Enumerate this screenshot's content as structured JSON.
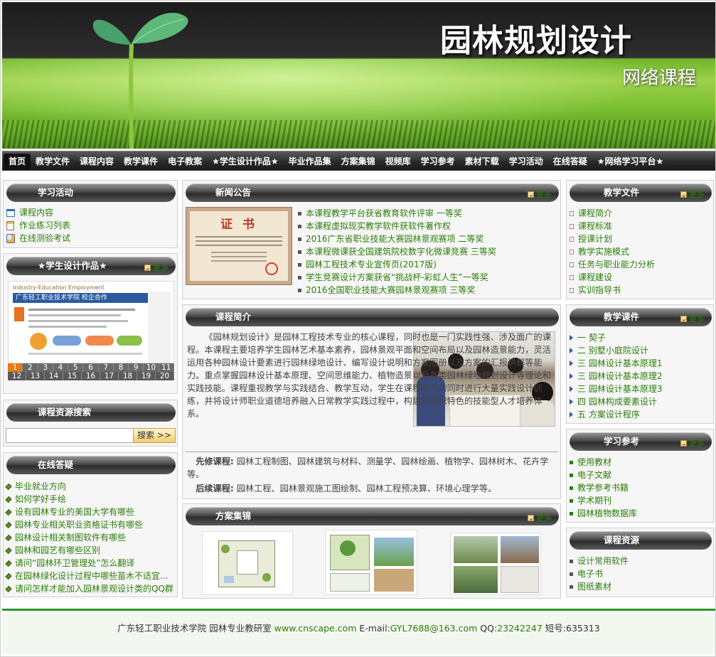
{
  "banner": {
    "title": "园林规划设计",
    "subtitle": "网络课程"
  },
  "nav": [
    {
      "label": "首页",
      "active": true
    },
    {
      "label": "教学文件"
    },
    {
      "label": "课程内容"
    },
    {
      "label": "教学课件"
    },
    {
      "label": "电子教案"
    },
    {
      "label": "★学生设计作品★"
    },
    {
      "label": "毕业作品集"
    },
    {
      "label": "方案集锦"
    },
    {
      "label": "视频库"
    },
    {
      "label": "学习参考"
    },
    {
      "label": "素材下载"
    },
    {
      "label": "学习活动"
    },
    {
      "label": "在线答疑"
    },
    {
      "label": "★网络学习平台★"
    }
  ],
  "more_label": "更多",
  "activity": {
    "title": "学习活动",
    "items": [
      {
        "label": "课程内容",
        "icon": "window-icon"
      },
      {
        "label": "作业练习列表",
        "icon": "notepad-icon"
      },
      {
        "label": "在线测验考试",
        "icon": "exam-icon"
      }
    ]
  },
  "student_works": {
    "title": "★学生设计作品★",
    "poster_title": "广东轻工职业技术学院 校企合作",
    "poster_sub": "Industry-Education Employment",
    "pages_row1": [
      "1",
      "2",
      "3",
      "4",
      "5",
      "6",
      "7",
      "8",
      "9",
      "10",
      "11"
    ],
    "pages_row2": [
      "12",
      "13",
      "14",
      "15",
      "16",
      "17",
      "18",
      "19",
      "20"
    ],
    "current_page": "1"
  },
  "search": {
    "title": "课程资源搜索",
    "placeholder": "",
    "button": "搜索 >>"
  },
  "qa": {
    "title": "在线答疑",
    "items": [
      "毕业就业方向",
      "如何学好手绘",
      "设有园林专业的美国大学有哪些",
      "园林专业相关职业资格证书有哪些",
      "园林设计相关制图软件有哪些",
      "园林和园艺有哪些区别",
      "请问“园林环卫管理处”怎么翻译",
      "在园林绿化设计过程中哪些苗木不适宜...",
      "请问怎样才能加入园林景观设计类的QQ群"
    ]
  },
  "news": {
    "title": "新闻公告",
    "cert_title": "证 书",
    "items": [
      "本课程教学平台获省教育软件评审 一等奖",
      "本课程虚拟现实教学软件获软件著作权",
      "2016广东省职业技能大赛园林景观赛项 二等奖",
      "本课程微课获全国建筑院校数字化微课竞赛 三等奖",
      "园林工程技术专业宣传页(2017版)",
      "学生竞赛设计方案获省“挑战杯-彩虹人生”一等奖",
      "2016全国职业技能大赛园林景观赛项 三等奖"
    ]
  },
  "intro": {
    "title": "课程简介",
    "text": "《园林规划设计》是园林工程技术专业的核心课程，同时也是一门实践性强、涉及面广的课程。本课程主要培养学生园林艺术基本素养，园林景观平面和空间布局以及园林造景能力，灵活运用各种园林设计要素进行园林绿地设计、编写设计说明和方案图册以及方案的汇报讲解等能力。重点掌握园林设计基本原理、空间思维能力、植物造景以及各类园林绿地规划设计等理论和实践技能。课程重视教学与实践结合、教学互动，学生在课程学习的同时进行大量实践设计训练，并将设计师职业道德培养融入日常教学实践过程中，构建具高职特色的技能型人才培养体系。",
    "pre_label": "先修课程:",
    "pre_text": "园林工程制图、园林建筑与材料、测量学、园林绘画、植物学、园林树木、花卉学等。",
    "post_label": "后续课程:",
    "post_text": "园林工程、园林景观施工图绘制、园林工程预决算、环境心理学等。"
  },
  "plans": {
    "title": "方案集锦"
  },
  "files": {
    "title": "教学文件",
    "items": [
      "课程简介",
      "课程标准",
      "授课计划",
      "教学实施模式",
      "任务与职业能力分析",
      "课程建设",
      "实训指导书"
    ]
  },
  "slides": {
    "title": "教学课件",
    "items": [
      "一 契子",
      "二 别墅小庭院设计",
      "三 园林设计基本原理1",
      "三 园林设计基本原理2",
      "三 园林设计基本原理3",
      "四 园林构成要素设计",
      "五 方案设计程序"
    ]
  },
  "refs": {
    "title": "学习参考",
    "items": [
      "使用教材",
      "电子文献",
      "教学参考书籍",
      "学术期刊",
      "园林植物数据库"
    ]
  },
  "resources": {
    "title": "课程资源",
    "items": [
      "设计常用软件",
      "电子书",
      "图纸素材"
    ]
  },
  "footer": {
    "school": "广东轻工职业技术学院 园林专业教研室",
    "site": "www.cnscape.com",
    "email_label": "E-mail:",
    "email": "GYL7688@163.com",
    "qq_label": "QQ:",
    "qq": "23242247",
    "sms_label": "短号:",
    "sms": "635313"
  },
  "colors": {
    "link_green": "#2d7d0a",
    "header_dark": "#2c2c2c",
    "footer_line": "#2a9a2a"
  }
}
